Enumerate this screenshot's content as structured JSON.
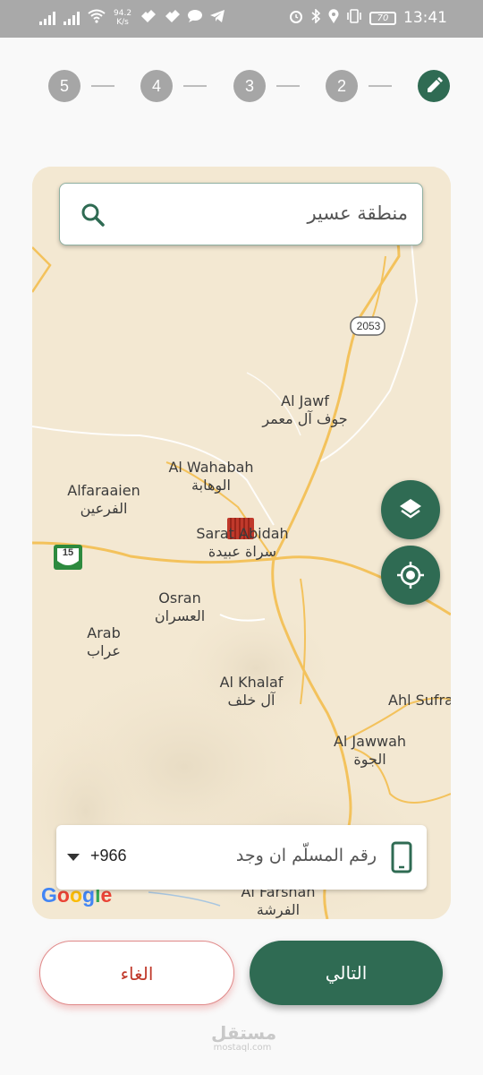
{
  "status_bar": {
    "network_speed": "94.2",
    "speed_unit": "K/s",
    "battery": "70",
    "time": "13:41"
  },
  "stepper": {
    "steps": [
      "5",
      "4",
      "3",
      "2"
    ]
  },
  "map": {
    "search_text": "منطقة عسير",
    "places": [
      {
        "en": "Al Jawf",
        "ar": "جوف آل معمر"
      },
      {
        "en": "Al Wahabah",
        "ar": "الوهابة"
      },
      {
        "en": "Alfaraaien",
        "ar": "الفرعين"
      },
      {
        "en": "Sarat Abidah",
        "ar": "سراة عبيدة"
      },
      {
        "en": "Osran",
        "ar": "العسران"
      },
      {
        "en": "Arab",
        "ar": "عراب"
      },
      {
        "en": "Al Khalaf",
        "ar": "آل خلف"
      },
      {
        "en": "Ahl Sufra",
        "ar": ""
      },
      {
        "en": "Al Jawwah",
        "ar": "الجوة"
      },
      {
        "en": "Al Farshah",
        "ar": "الفرشة"
      }
    ],
    "road_labels": [
      "2053",
      "15"
    ],
    "attribution": "Google"
  },
  "phone_field": {
    "placeholder": "رقم المسلّم ان وجد",
    "country_code": "+966"
  },
  "actions": {
    "next_label": "التالي",
    "cancel_label": "الغاء"
  },
  "watermark": {
    "ar": "مستقل",
    "en": "mostaql.com"
  },
  "colors": {
    "primary": "#2f6b53",
    "cancel_text": "#c0392b",
    "map_bg": "#f2e6cf",
    "road": "#f3c25c"
  }
}
